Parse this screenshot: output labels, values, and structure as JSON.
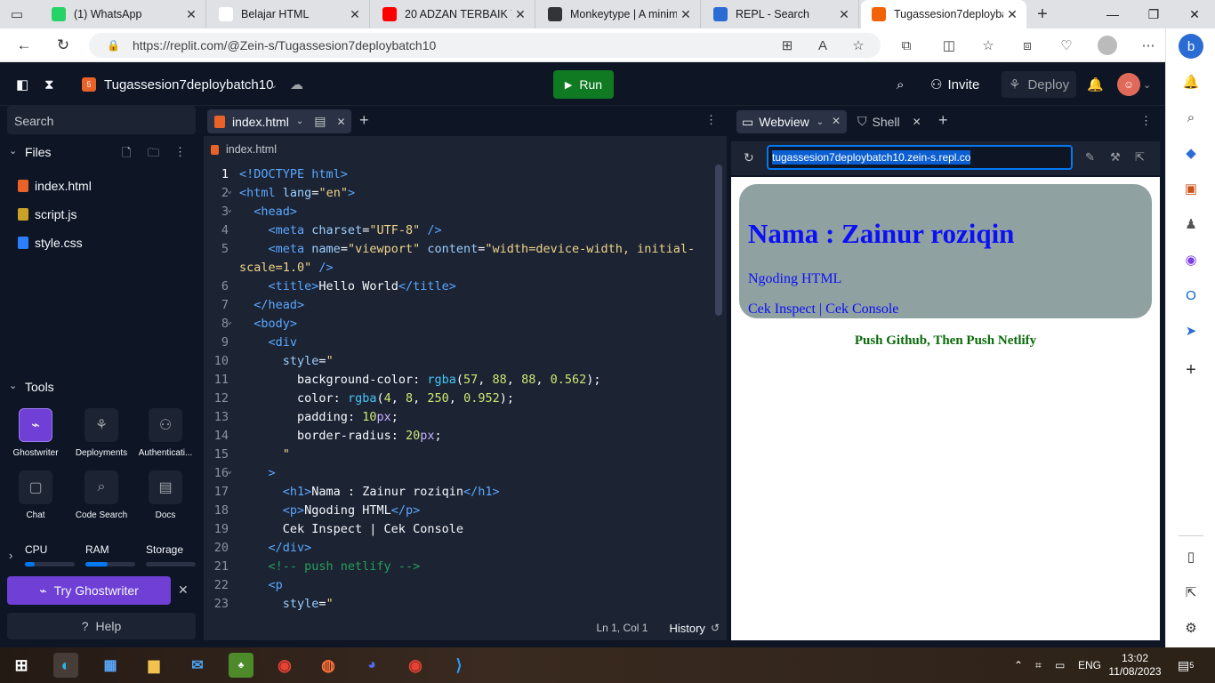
{
  "browser": {
    "tabs": [
      {
        "title": "(1) WhatsApp",
        "favicon": "whatsapp-icon",
        "color": "#25d366"
      },
      {
        "title": "Belajar HTML",
        "favicon": "page-icon",
        "color": "#ffffff"
      },
      {
        "title": "20 ADZAN TERBAIK YA",
        "favicon": "youtube-icon",
        "color": "#ff0000"
      },
      {
        "title": "Monkeytype | A minim",
        "favicon": "monkeytype-icon",
        "color": "#323437"
      },
      {
        "title": "REPL - Search",
        "favicon": "search-icon",
        "color": "#2b6cd4"
      },
      {
        "title": "Tugassesion7deployba",
        "favicon": "replit-icon",
        "color": "#f26207",
        "active": true
      }
    ],
    "url": "https://replit.com/@Zein-s/Tugassesion7deploybatch10"
  },
  "repl": {
    "name": "Tugassesion7deploybatch10",
    "run_label": "Run",
    "invite_label": "Invite",
    "deploy_label": "Deploy"
  },
  "sidebar": {
    "search_placeholder": "Search",
    "files_label": "Files",
    "files": [
      {
        "name": "index.html",
        "type": "html",
        "color": "#e96228"
      },
      {
        "name": "script.js",
        "type": "js",
        "color": "#c9a227"
      },
      {
        "name": "style.css",
        "type": "css",
        "color": "#2b7fff"
      }
    ],
    "tools_label": "Tools",
    "tools": [
      {
        "label": "Ghostwriter",
        "icon": "ghostwriter-icon"
      },
      {
        "label": "Deployments",
        "icon": "deployments-icon"
      },
      {
        "label": "Authenticati...",
        "icon": "authentication-icon"
      },
      {
        "label": "Chat",
        "icon": "chat-icon"
      },
      {
        "label": "Code Search",
        "icon": "code-search-icon"
      },
      {
        "label": "Docs",
        "icon": "docs-icon"
      }
    ],
    "resources": {
      "cpu_label": "CPU",
      "ram_label": "RAM",
      "storage_label": "Storage",
      "cpu": 0.2,
      "ram": 0.45,
      "storage": 0.0
    },
    "try_ghostwriter_label": "Try Ghostwriter",
    "help_label": "Help"
  },
  "editor": {
    "tab_label": "index.html",
    "breadcrumb": "index.html",
    "status_position": "Ln 1, Col 1",
    "status_history": "History",
    "line_numbers": [
      "1",
      "2",
      "3",
      "4",
      "5",
      "",
      "6",
      "7",
      "8",
      "9",
      "10",
      "11",
      "12",
      "13",
      "14",
      "15",
      "16",
      "17",
      "18",
      "19",
      "20",
      "21",
      "22",
      "23"
    ]
  },
  "preview": {
    "tab_label": "Webview",
    "shell_label": "Shell",
    "url": "tugassesion7deploybatch10.zein-s.repl.co",
    "heading": "Nama : Zainur roziqin",
    "paragraph": "Ngoding HTML",
    "line2": "Cek Inspect | Cek Console",
    "push_note": "Push Github, Then Push Netlify"
  },
  "taskbar": {
    "lang": "ENG",
    "time": "13:02",
    "date": "11/08/2023",
    "notifications": "5"
  }
}
